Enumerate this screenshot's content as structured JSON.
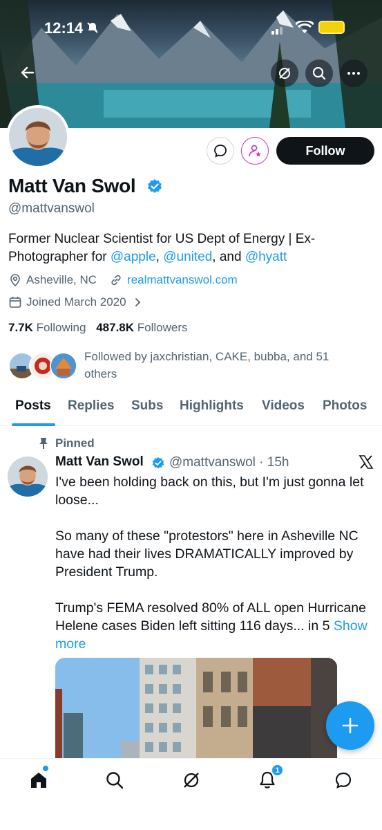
{
  "status_bar": {
    "time": "12:14"
  },
  "profile": {
    "name": "Matt Van Swol",
    "handle": "@mattvanswol",
    "bio_prefix": "Former Nuclear Scientist for US Dept of Energy | Ex-Photographer for ",
    "bio_mention_1": "@apple",
    "bio_sep_1": ", ",
    "bio_mention_2": "@united",
    "bio_sep_2": ", and ",
    "bio_mention_3": "@hyatt",
    "location": "Asheville, NC",
    "website": "realmattvanswol.com",
    "joined": "Joined March 2020",
    "following_count": "7.7K",
    "following_label": "Following",
    "followers_count": "487.8K",
    "followers_label": "Followers",
    "followed_by": "Followed by jaxchristian, CAKE, bubba, and 51 others",
    "follow_button": "Follow"
  },
  "tabs": [
    {
      "label": "Posts"
    },
    {
      "label": "Replies"
    },
    {
      "label": "Subs"
    },
    {
      "label": "Highlights"
    },
    {
      "label": "Videos"
    },
    {
      "label": "Photos"
    }
  ],
  "post": {
    "pinned_label": "Pinned",
    "author_name": "Matt Van Swol",
    "author_handle_time": "@mattvanswol · 15h",
    "text": "I've been holding back on this, but I'm just gonna let loose...\n\nSo many of these \"protestors\" here in Asheville NC have had their lives DRAMATICALLY improved by President Trump.\n\nTrump's FEMA resolved 80% of ALL open Hurricane Helene cases Biden left sitting 116 days... in 5 ",
    "show_more": "Show more"
  },
  "nav": {
    "notifications_badge": "1"
  },
  "colors": {
    "accent": "#1d9bf0",
    "text": "#0f1419",
    "muted": "#536471",
    "follow_bg": "#0f1419"
  },
  "icons": [
    "back-arrow-icon",
    "grok-icon",
    "search-icon",
    "more-icon",
    "message-icon",
    "subscribe-icon",
    "verified-icon",
    "location-icon",
    "link-icon",
    "calendar-icon",
    "chevron-right-icon",
    "pin-icon",
    "x-logo-icon",
    "plus-icon",
    "home-icon",
    "notifications-icon",
    "messages-icon"
  ]
}
